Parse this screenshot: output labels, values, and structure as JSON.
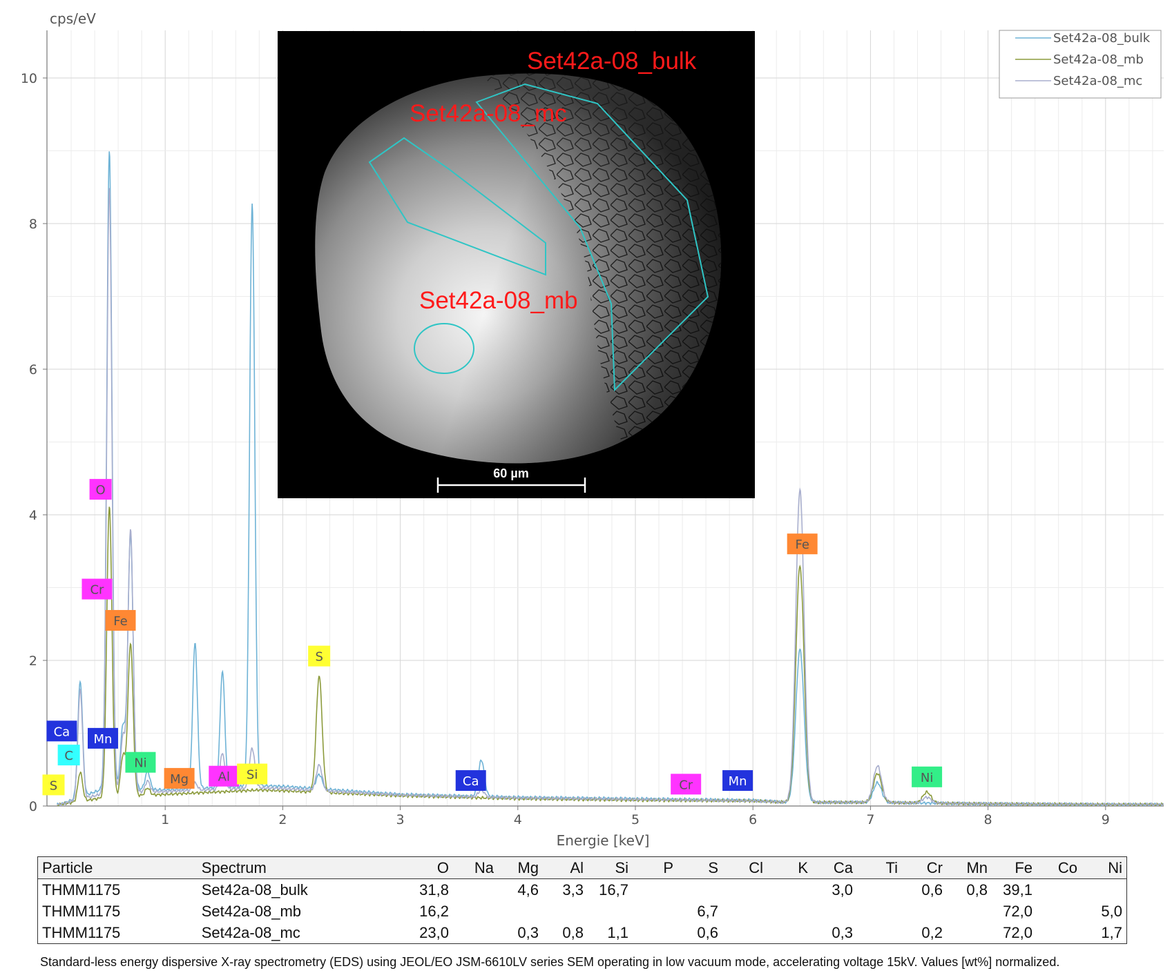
{
  "chart_data": {
    "type": "line",
    "ylabel": "cps/eV",
    "xlabel": "Energie [keV]",
    "xlim": [
      0.0,
      9.65
    ],
    "ylim": [
      0,
      10.6
    ],
    "x_ticks": [
      1,
      2,
      3,
      4,
      5,
      6,
      7,
      8,
      9
    ],
    "y_ticks": [
      0,
      2,
      4,
      6,
      8,
      10
    ],
    "grid": true,
    "legend_position": "top-right",
    "series": [
      {
        "name": "Set42a-08_bulk",
        "color": "#6fb3d6",
        "baseline": [
          [
            0.1,
            0.02
          ],
          [
            0.5,
            0.25
          ],
          [
            1.0,
            0.22
          ],
          [
            1.8,
            0.28
          ],
          [
            2.0,
            0.27
          ],
          [
            3.0,
            0.16
          ],
          [
            4.0,
            0.12
          ],
          [
            5.0,
            0.1
          ],
          [
            6.0,
            0.08
          ],
          [
            6.3,
            0.05
          ],
          [
            7.0,
            0.05
          ],
          [
            8.0,
            0.03
          ],
          [
            9.0,
            0.02
          ],
          [
            9.65,
            0.02
          ]
        ],
        "peaks": [
          [
            0.277,
            1.6,
            0.02
          ],
          [
            0.525,
            8.75,
            0.022
          ],
          [
            0.64,
            0.85,
            0.02
          ],
          [
            0.705,
            3.5,
            0.022
          ],
          [
            0.85,
            0.25,
            0.02
          ],
          [
            1.254,
            2.0,
            0.02
          ],
          [
            1.487,
            1.6,
            0.02
          ],
          [
            1.74,
            8.0,
            0.022
          ],
          [
            2.31,
            0.2,
            0.025
          ],
          [
            3.69,
            0.5,
            0.025
          ],
          [
            6.4,
            2.1,
            0.035
          ],
          [
            7.06,
            0.27,
            0.035
          ]
        ]
      },
      {
        "name": "Set42a-08_mb",
        "color": "#8c9b3c",
        "baseline": [
          [
            0.1,
            0.02
          ],
          [
            0.5,
            0.12
          ],
          [
            1.0,
            0.16
          ],
          [
            1.8,
            0.22
          ],
          [
            2.0,
            0.21
          ],
          [
            3.0,
            0.14
          ],
          [
            4.0,
            0.1
          ],
          [
            5.0,
            0.08
          ],
          [
            6.0,
            0.07
          ],
          [
            6.3,
            0.05
          ],
          [
            7.0,
            0.05
          ],
          [
            8.0,
            0.03
          ],
          [
            9.0,
            0.02
          ],
          [
            9.65,
            0.02
          ]
        ],
        "peaks": [
          [
            0.277,
            0.4,
            0.02
          ],
          [
            0.525,
            4.0,
            0.022
          ],
          [
            0.64,
            0.55,
            0.02
          ],
          [
            0.705,
            2.1,
            0.022
          ],
          [
            0.85,
            0.1,
            0.02
          ],
          [
            2.31,
            1.6,
            0.025
          ],
          [
            6.4,
            3.25,
            0.035
          ],
          [
            7.06,
            0.4,
            0.035
          ],
          [
            7.48,
            0.15,
            0.035
          ]
        ]
      },
      {
        "name": "Set42a-08_mc",
        "color": "#a8aecd",
        "baseline": [
          [
            0.1,
            0.02
          ],
          [
            0.5,
            0.18
          ],
          [
            1.0,
            0.2
          ],
          [
            1.8,
            0.25
          ],
          [
            2.0,
            0.24
          ],
          [
            3.0,
            0.15
          ],
          [
            4.0,
            0.11
          ],
          [
            5.0,
            0.09
          ],
          [
            6.0,
            0.07
          ],
          [
            6.3,
            0.05
          ],
          [
            7.0,
            0.05
          ],
          [
            8.0,
            0.03
          ],
          [
            9.0,
            0.02
          ],
          [
            9.65,
            0.02
          ]
        ],
        "peaks": [
          [
            0.277,
            1.5,
            0.02
          ],
          [
            0.525,
            8.3,
            0.022
          ],
          [
            0.64,
            0.75,
            0.02
          ],
          [
            0.705,
            3.6,
            0.022
          ],
          [
            0.85,
            0.15,
            0.02
          ],
          [
            1.254,
            0.1,
            0.02
          ],
          [
            1.487,
            0.5,
            0.02
          ],
          [
            1.74,
            0.55,
            0.022
          ],
          [
            2.31,
            0.35,
            0.025
          ],
          [
            3.69,
            0.1,
            0.025
          ],
          [
            6.4,
            4.3,
            0.035
          ],
          [
            7.06,
            0.5,
            0.035
          ],
          [
            7.48,
            0.08,
            0.035
          ]
        ]
      }
    ],
    "element_labels": [
      {
        "text": "S",
        "x": 0.05,
        "y": 0.29,
        "color": "#ffff33"
      },
      {
        "text": "C",
        "x": 0.18,
        "y": 0.7,
        "color": "#33ffff"
      },
      {
        "text": "Ca",
        "x": 0.12,
        "y": 1.03,
        "color": "#2233dd"
      },
      {
        "text": "O",
        "x": 0.45,
        "y": 4.35,
        "color": "#ff33ff"
      },
      {
        "text": "Cr",
        "x": 0.42,
        "y": 2.98,
        "color": "#ff33ff"
      },
      {
        "text": "Fe",
        "x": 0.62,
        "y": 2.55,
        "color": "#ff8833"
      },
      {
        "text": "Mn",
        "x": 0.47,
        "y": 0.93,
        "color": "#2233dd"
      },
      {
        "text": "Ni",
        "x": 0.79,
        "y": 0.6,
        "color": "#33ee88"
      },
      {
        "text": "Mg",
        "x": 1.12,
        "y": 0.38,
        "color": "#ff8833"
      },
      {
        "text": "Al",
        "x": 1.5,
        "y": 0.41,
        "color": "#ff33ff"
      },
      {
        "text": "Si",
        "x": 1.74,
        "y": 0.44,
        "color": "#ffff33"
      },
      {
        "text": "S",
        "x": 2.31,
        "y": 2.06,
        "color": "#ffff33"
      },
      {
        "text": "Ca",
        "x": 3.6,
        "y": 0.35,
        "color": "#2233dd"
      },
      {
        "text": "Cr",
        "x": 5.43,
        "y": 0.3,
        "color": "#ff33ff"
      },
      {
        "text": "Mn",
        "x": 5.87,
        "y": 0.35,
        "color": "#2233dd"
      },
      {
        "text": "Fe",
        "x": 6.42,
        "y": 3.6,
        "color": "#ff8833"
      },
      {
        "text": "Ni",
        "x": 7.48,
        "y": 0.4,
        "color": "#33ee88"
      }
    ]
  },
  "inset": {
    "labels": [
      "Set42a-08_bulk",
      "Set42a-08_mc",
      "Set42a-08_mb"
    ],
    "scale_bar": "60 µm",
    "outline_color": "#2fc5c5"
  },
  "table": {
    "headers": [
      "Particle",
      "Spectrum",
      "O",
      "Na",
      "Mg",
      "Al",
      "Si",
      "P",
      "S",
      "Cl",
      "K",
      "Ca",
      "Ti",
      "Cr",
      "Mn",
      "Fe",
      "Co",
      "Ni"
    ],
    "rows": [
      [
        "THMM1175",
        "Set42a-08_bulk",
        "31,8",
        "",
        "4,6",
        "3,3",
        "16,7",
        "",
        "",
        "",
        "",
        "3,0",
        "",
        "0,6",
        "0,8",
        "39,1",
        "",
        ""
      ],
      [
        "THMM1175",
        "Set42a-08_mb",
        "16,2",
        "",
        "",
        "",
        "",
        "",
        "6,7",
        "",
        "",
        "",
        "",
        "",
        "",
        "72,0",
        "",
        "5,0"
      ],
      [
        "THMM1175",
        "Set42a-08_mc",
        "23,0",
        "",
        "0,3",
        "0,8",
        "1,1",
        "",
        "0,6",
        "",
        "",
        "0,3",
        "",
        "0,2",
        "",
        "72,0",
        "",
        "1,7"
      ]
    ]
  },
  "caption": "Standard-less energy dispersive X-ray spectrometry (EDS) using JEOL/EO JSM-6610LV series SEM operating in low vacuum mode, accelerating voltage 15kV. Values [wt%] normalized."
}
